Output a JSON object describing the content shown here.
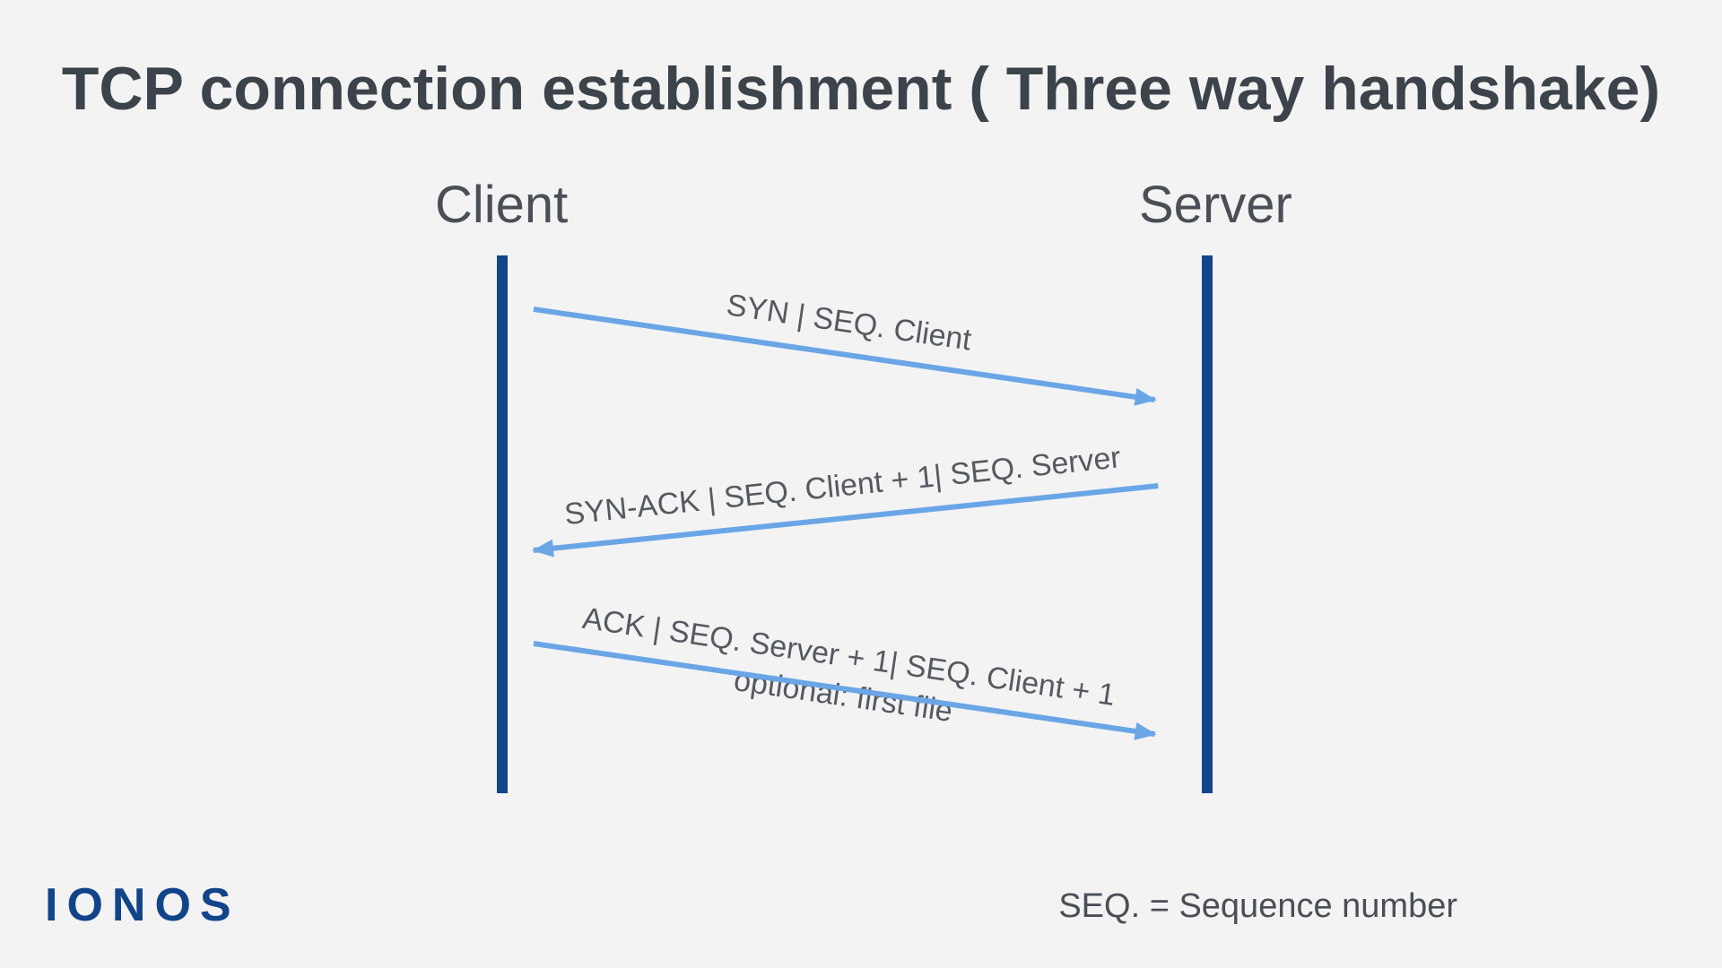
{
  "title": "TCP connection establishment ( Three way handshake)",
  "clientLabel": "Client",
  "serverLabel": "Server",
  "arrows": {
    "a1": {
      "label": "SYN | SEQ. Client"
    },
    "a2": {
      "label": "SYN-ACK | SEQ. Client + 1| SEQ. Server"
    },
    "a3": {
      "label": "ACK | SEQ. Server + 1| SEQ. Client + 1",
      "sublabel": "optional: first file"
    }
  },
  "footnote": "SEQ. = Sequence number",
  "logo": "IONOS"
}
